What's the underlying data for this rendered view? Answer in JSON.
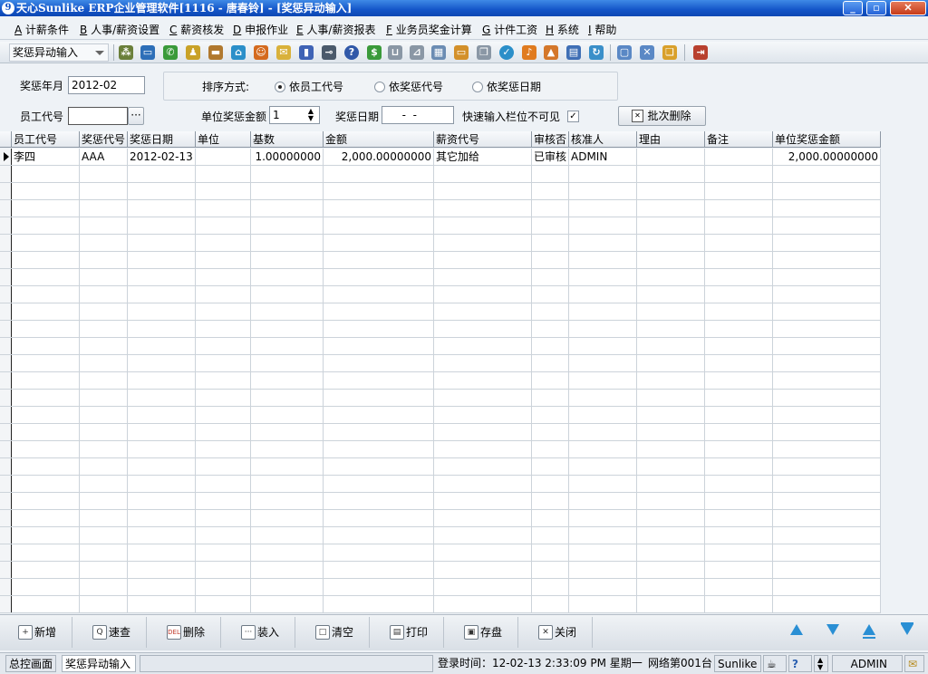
{
  "window": {
    "title": "天心Sunlike ERP企业管理软件[1116 - 唐春铃] - [奖惩异动输入]",
    "app_icon": "sunlike-logo-icon"
  },
  "menu": [
    {
      "key": "A",
      "label": "计薪条件"
    },
    {
      "key": "B",
      "label": "人事/薪资设置"
    },
    {
      "key": "C",
      "label": "薪资核发"
    },
    {
      "key": "D",
      "label": "申报作业"
    },
    {
      "key": "E",
      "label": "人事/薪资报表"
    },
    {
      "key": "F",
      "label": "业务员奖金计算"
    },
    {
      "key": "G",
      "label": "计件工资"
    },
    {
      "key": "H",
      "label": "系统"
    },
    {
      "key": "I",
      "label": "帮助"
    }
  ],
  "toolbar": {
    "module_select": "奖惩异动输入"
  },
  "form": {
    "period_label": "奖惩年月",
    "period_value": "2012-02",
    "sort_label": "排序方式:",
    "sort_options": [
      "依员工代号",
      "依奖惩代号",
      "依奖惩日期"
    ],
    "sort_selected": 0,
    "employee_label": "员工代号",
    "employee_value": "",
    "ellipsis": "···",
    "unit_amount_label": "单位奖惩金额",
    "unit_amount_value": "1",
    "date_label": "奖惩日期",
    "date_value": "  -  -  ",
    "quick_input_label": "快速输入栏位不可见",
    "quick_input_checked": true,
    "check_mark": "✓",
    "batch_delete": "批次删除"
  },
  "grid": {
    "columns": [
      "员工代号",
      "奖惩代号",
      "奖惩日期",
      "单位",
      "基数",
      "金额",
      "薪资代号",
      "审核否",
      "核准人",
      "理由",
      "备注",
      "单位奖惩金额"
    ],
    "rows": [
      [
        "李四",
        "AAA",
        "2012-02-13",
        "",
        "1.00000000",
        "2,000.00000000",
        "其它加给",
        "已审核",
        "ADMIN",
        "",
        "",
        "2,000.00000000"
      ]
    ]
  },
  "buttons": [
    {
      "label": "新增",
      "icon": "add-icon",
      "glyph": "+"
    },
    {
      "label": "速查",
      "icon": "search-icon",
      "glyph": "Q"
    },
    {
      "label": "删除",
      "icon": "delete-icon",
      "glyph": "DEL"
    },
    {
      "label": "装入",
      "icon": "load-icon",
      "glyph": "···"
    },
    {
      "label": "清空",
      "icon": "clear-icon",
      "glyph": "□"
    },
    {
      "label": "打印",
      "icon": "print-icon",
      "glyph": "▤"
    },
    {
      "label": "存盘",
      "icon": "save-icon",
      "glyph": "▣"
    },
    {
      "label": "关闭",
      "icon": "close-icon",
      "glyph": "✕"
    }
  ],
  "status": {
    "tab1": "总控画面",
    "tab2": "奖惩异动输入",
    "login": "登录时间：12-02-13 2:33:09 PM  星期一",
    "network": "网络第001台",
    "company": "Sunlike E",
    "user": "ADMIN"
  },
  "colors": {
    "title_bar": "#1455c8",
    "grid_line": "#ccd3da"
  }
}
